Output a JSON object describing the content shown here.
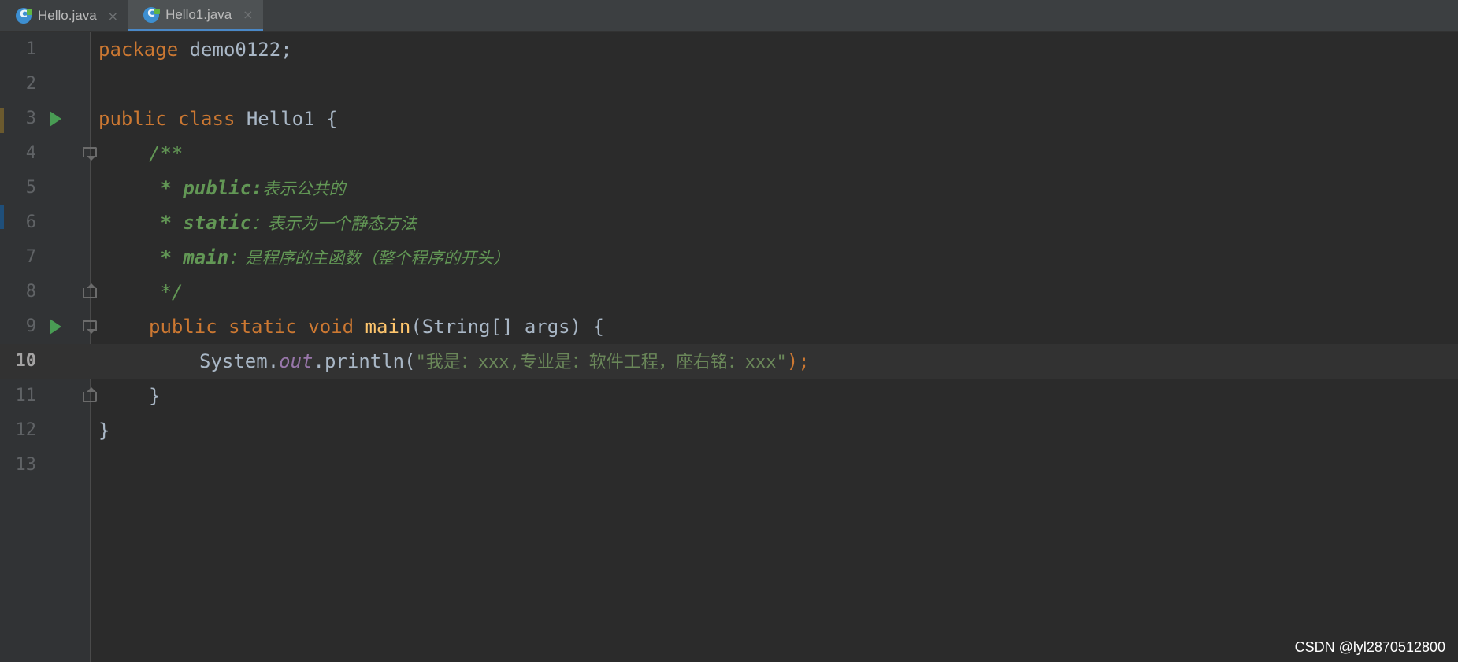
{
  "tabs": [
    {
      "label": "Hello.java",
      "close": "×",
      "active": false
    },
    {
      "label": "Hello1.java",
      "close": "×",
      "active": true
    }
  ],
  "current_line": 10,
  "lines": {
    "l1": {
      "number": "1",
      "parts": [
        "package",
        " demo0122;"
      ]
    },
    "l2": {
      "number": "2"
    },
    "l3": {
      "number": "3",
      "parts": [
        "public class",
        " Hello1 {"
      ]
    },
    "l4": {
      "number": "4",
      "parts": [
        "/**"
      ]
    },
    "l5": {
      "number": "5",
      "parts": [
        " * public:",
        "表示公共的"
      ]
    },
    "l6": {
      "number": "6",
      "parts": [
        " * static",
        "：表示为一个静态方法"
      ]
    },
    "l7": {
      "number": "7",
      "parts": [
        " * main",
        "：是程序的主函数（整个程序的开头）"
      ]
    },
    "l8": {
      "number": "8",
      "parts": [
        " */"
      ]
    },
    "l9": {
      "number": "9",
      "parts": [
        "public static void",
        " ",
        "main",
        "(String[] args) {"
      ]
    },
    "l10": {
      "number": "10",
      "parts": [
        "System.",
        "out",
        ".println(",
        "\"我是：xxx,专业是：软件工程，座右铭：xxx\"",
        ");"
      ]
    },
    "l11": {
      "number": "11",
      "parts": [
        "}"
      ]
    },
    "l12": {
      "number": "12",
      "parts": [
        "}"
      ]
    },
    "l13": {
      "number": "13"
    }
  },
  "watermark": "CSDN @lyl2870512800",
  "colors": {
    "background": "#2b2b2b",
    "keyword": "#cc7832",
    "method": "#ffc66d",
    "javadoc": "#629755",
    "string": "#6a8759",
    "field": "#9876aa",
    "run_icon": "#499c54"
  }
}
